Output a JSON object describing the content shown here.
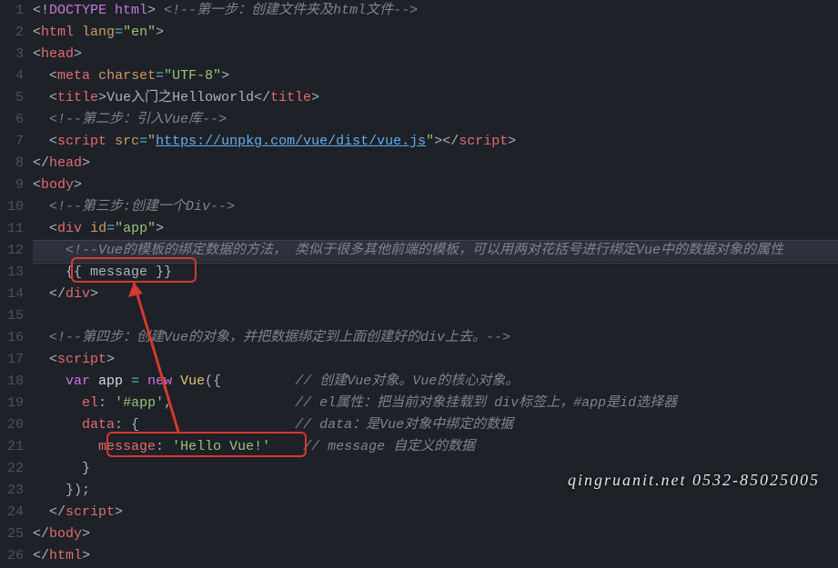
{
  "gutter": [
    "1",
    "2",
    "3",
    "4",
    "5",
    "6",
    "7",
    "8",
    "9",
    "10",
    "11",
    "12",
    "13",
    "14",
    "15",
    "16",
    "17",
    "18",
    "19",
    "20",
    "21",
    "22",
    "23",
    "24",
    "25",
    "26"
  ],
  "lines": {
    "l1_dt1": "DOCTYPE html",
    "l1_cm": "<!--第一步：创建文件夹及html文件-->",
    "l2_lang": "lang",
    "l2_en": "\"en\"",
    "l4_charset": "charset",
    "l4_utf": "\"UTF-8\"",
    "l5_title": "Vue入门之Helloworld",
    "l6_cm": "<!--第二步：引入Vue库-->",
    "l7_src": "src",
    "l7_url": "https://unpkg.com/vue/dist/vue.js",
    "l10_cm": "<!--第三步:创建一个Div-->",
    "l11_id": "id",
    "l11_app": "\"app\"",
    "l12_cm": "<!--Vue的模板的绑定数据的方法， 类似于很多其他前端的模板，可以用两对花括号进行绑定Vue中的数据对象的属性",
    "l13_msg": "{{ message }}",
    "l16_cm": "<!--第四步：创建Vue的对象，并把数据绑定到上面创建好的div上去。-->",
    "l18_var": "var",
    "l18_app": "app",
    "l18_new": "new",
    "l18_vue": "Vue",
    "l18_cm": "// 创建Vue对象。Vue的核心对象。",
    "l19_el": "el",
    "l19_val": "'#app'",
    "l19_cm": "// el属性：把当前对象挂载到 div标签上，#app是id选择器",
    "l20_data": "data",
    "l20_cm": "// data：是Vue对象中绑定的数据",
    "l21_msg": "message",
    "l21_val": "'Hello Vue!'",
    "l21_cm": "// message 自定义的数据"
  },
  "tags": {
    "html": "html",
    "head": "head",
    "meta": "meta",
    "title": "title",
    "script": "script",
    "body": "body",
    "div": "div"
  },
  "watermark": "qingruanit.net 0532-85025005"
}
